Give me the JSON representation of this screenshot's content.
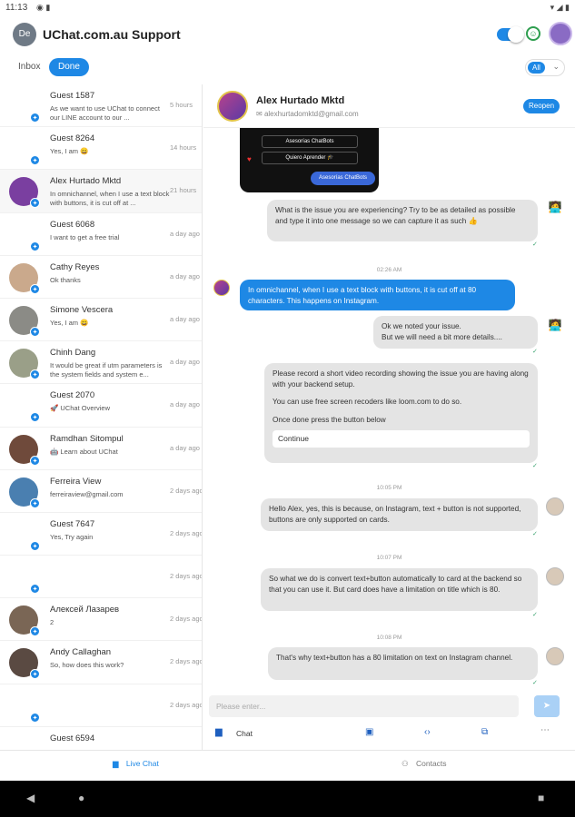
{
  "status_bar": {
    "time": "11:13",
    "left_icons": "◉ ▮",
    "right_icons": "▾ ◢ ▮"
  },
  "header": {
    "workspace_initials": "De",
    "workspace_title": "UChat.com.au Support",
    "online_toggle": true
  },
  "filters": {
    "inbox_label": "Inbox",
    "done_label": "Done",
    "all_label": "All"
  },
  "conversations": [
    {
      "name": "Guest 1587",
      "preview": "As we want to use UChat to connect our LINE account to our ...",
      "time": "5 hours",
      "avatar_color": "#ffffff"
    },
    {
      "name": "Guest 8264",
      "preview": "Yes, I am 😀",
      "time": "14 hours",
      "avatar_color": "#ffffff"
    },
    {
      "name": "Alex Hurtado Mktd",
      "preview": "In omnichannel, when I use a text block with buttons, it is cut off at ...",
      "time": "21 hours",
      "avatar_color": "#7a3fa0"
    },
    {
      "name": "Guest 6068",
      "preview": "I want to get a free trial",
      "time": "a day ago",
      "avatar_color": "#ffffff"
    },
    {
      "name": "Cathy Reyes",
      "preview": "Ok thanks",
      "time": "a day ago",
      "avatar_color": "#caa98c"
    },
    {
      "name": "Simone Vescera",
      "preview": "Yes, I am 😀",
      "time": "a day ago",
      "avatar_color": "#8b8b86"
    },
    {
      "name": "Chinh Dang",
      "preview": "It would be great if utm parameters is the system fields and system e...",
      "time": "a day ago",
      "avatar_color": "#9a9f88"
    },
    {
      "name": "Guest 2070",
      "preview": "🚀 UChat Overview",
      "time": "a day ago",
      "avatar_color": "#ffffff"
    },
    {
      "name": "Ramdhan Sitompul",
      "preview": "🤖 Learn about UChat",
      "time": "a day ago",
      "avatar_color": "#6f4a3b"
    },
    {
      "name": "Ferreira View",
      "preview": "ferreiraview@gmail.com",
      "time": "2 days ago",
      "avatar_color": "#4a7fb0"
    },
    {
      "name": "Guest 7647",
      "preview": "Yes, Try again",
      "time": "2 days ago",
      "avatar_color": "#ffffff"
    },
    {
      "name": "",
      "preview": "",
      "time": "2 days ago",
      "avatar_color": "#ffffff"
    },
    {
      "name": "Алексей Лазарев",
      "preview": "2",
      "time": "2 days ago",
      "avatar_color": "#7a6655"
    },
    {
      "name": "Andy Callaghan",
      "preview": "So, how does this work?",
      "time": "2 days ago",
      "avatar_color": "#5a4a42"
    },
    {
      "name": "",
      "preview": "",
      "time": "2 days ago",
      "avatar_color": "#ffffff"
    },
    {
      "name": "Guest 6594",
      "preview": "",
      "time": "",
      "avatar_color": "#ffffff"
    }
  ],
  "chat": {
    "contact_name": "Alex Hurtado Mktd",
    "contact_email": "alexhurtadomktd@gmail.com",
    "reopen_label": "Reopen",
    "card": {
      "options": [
        "Asesorías ChatBots",
        "Quiero Aprender 🎓"
      ],
      "button": "Asesorías ChatBots"
    },
    "msg_issue_prompt": "What is the issue you are experiencing? Try to be as detailed as possible and type it into one message so we can capture it as such 👍",
    "ts1": "02:26 AM",
    "msg_customer": "In omnichannel, when I use a text block with buttons, it is cut off at 80 characters. This happens on Instagram.",
    "msg_noted": "Ok we noted your issue.\nBut we will need a bit more details....",
    "msg_record_1": "Please record a short video recording showing the issue you are having along with your backend setup.",
    "msg_record_2": "You can use free screen recoders like loom.com to do so.",
    "msg_record_3": "Once done press the button below",
    "continue_label": "Continue",
    "ts2": "10:05 PM",
    "msg_agent_1": "Hello Alex, yes, this is because, on Instagram, text + button is not supported, buttons are only supported on cards.",
    "ts3": "10:07 PM",
    "msg_agent_2": "So what we do is convert text+button automatically to card at the backend so that you can use it. But card does have a limitation on title which is 80.",
    "ts4": "10:08 PM",
    "msg_agent_3": "That's why text+button has a 80 limitation on text on Instagram channel.",
    "composer_placeholder": "Please enter..."
  },
  "toolbar": {
    "chat_label": "Chat"
  },
  "bottom_nav": {
    "live_chat": "Live Chat",
    "contacts": "Contacts"
  },
  "colors": {
    "accent": "#1e88e5",
    "bubble_gray": "#e4e4e4"
  }
}
